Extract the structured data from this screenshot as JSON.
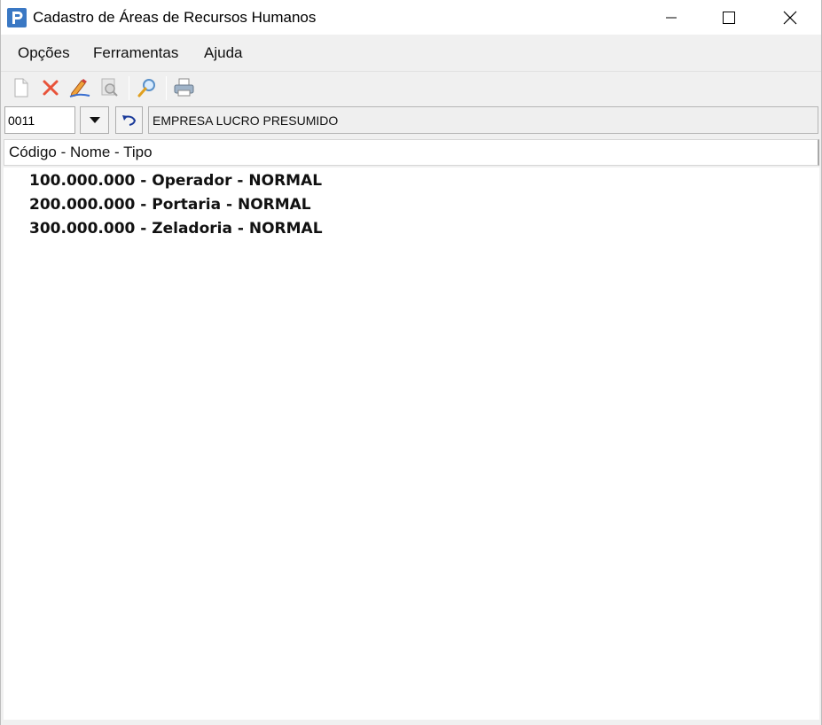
{
  "window": {
    "title": "Cadastro de Áreas de Recursos Humanos",
    "app_icon_letter": "P"
  },
  "menu": {
    "items": [
      {
        "label": "Opções"
      },
      {
        "label": "Ferramentas"
      },
      {
        "label": "Ajuda"
      }
    ]
  },
  "toolbar": {
    "buttons": [
      {
        "icon": "new-document-icon"
      },
      {
        "icon": "delete-icon"
      },
      {
        "icon": "edit-icon"
      },
      {
        "icon": "view-icon"
      },
      {
        "icon": "search-icon"
      },
      {
        "icon": "print-icon"
      }
    ]
  },
  "company": {
    "code": "0011",
    "name": "EMPRESA LUCRO PRESUMIDO"
  },
  "list": {
    "header": "Código - Nome - Tipo",
    "items": [
      {
        "text": "100.000.000 - Operador - NORMAL"
      },
      {
        "text": "200.000.000 - Portaria - NORMAL"
      },
      {
        "text": "300.000.000 - Zeladoria - NORMAL"
      }
    ]
  }
}
